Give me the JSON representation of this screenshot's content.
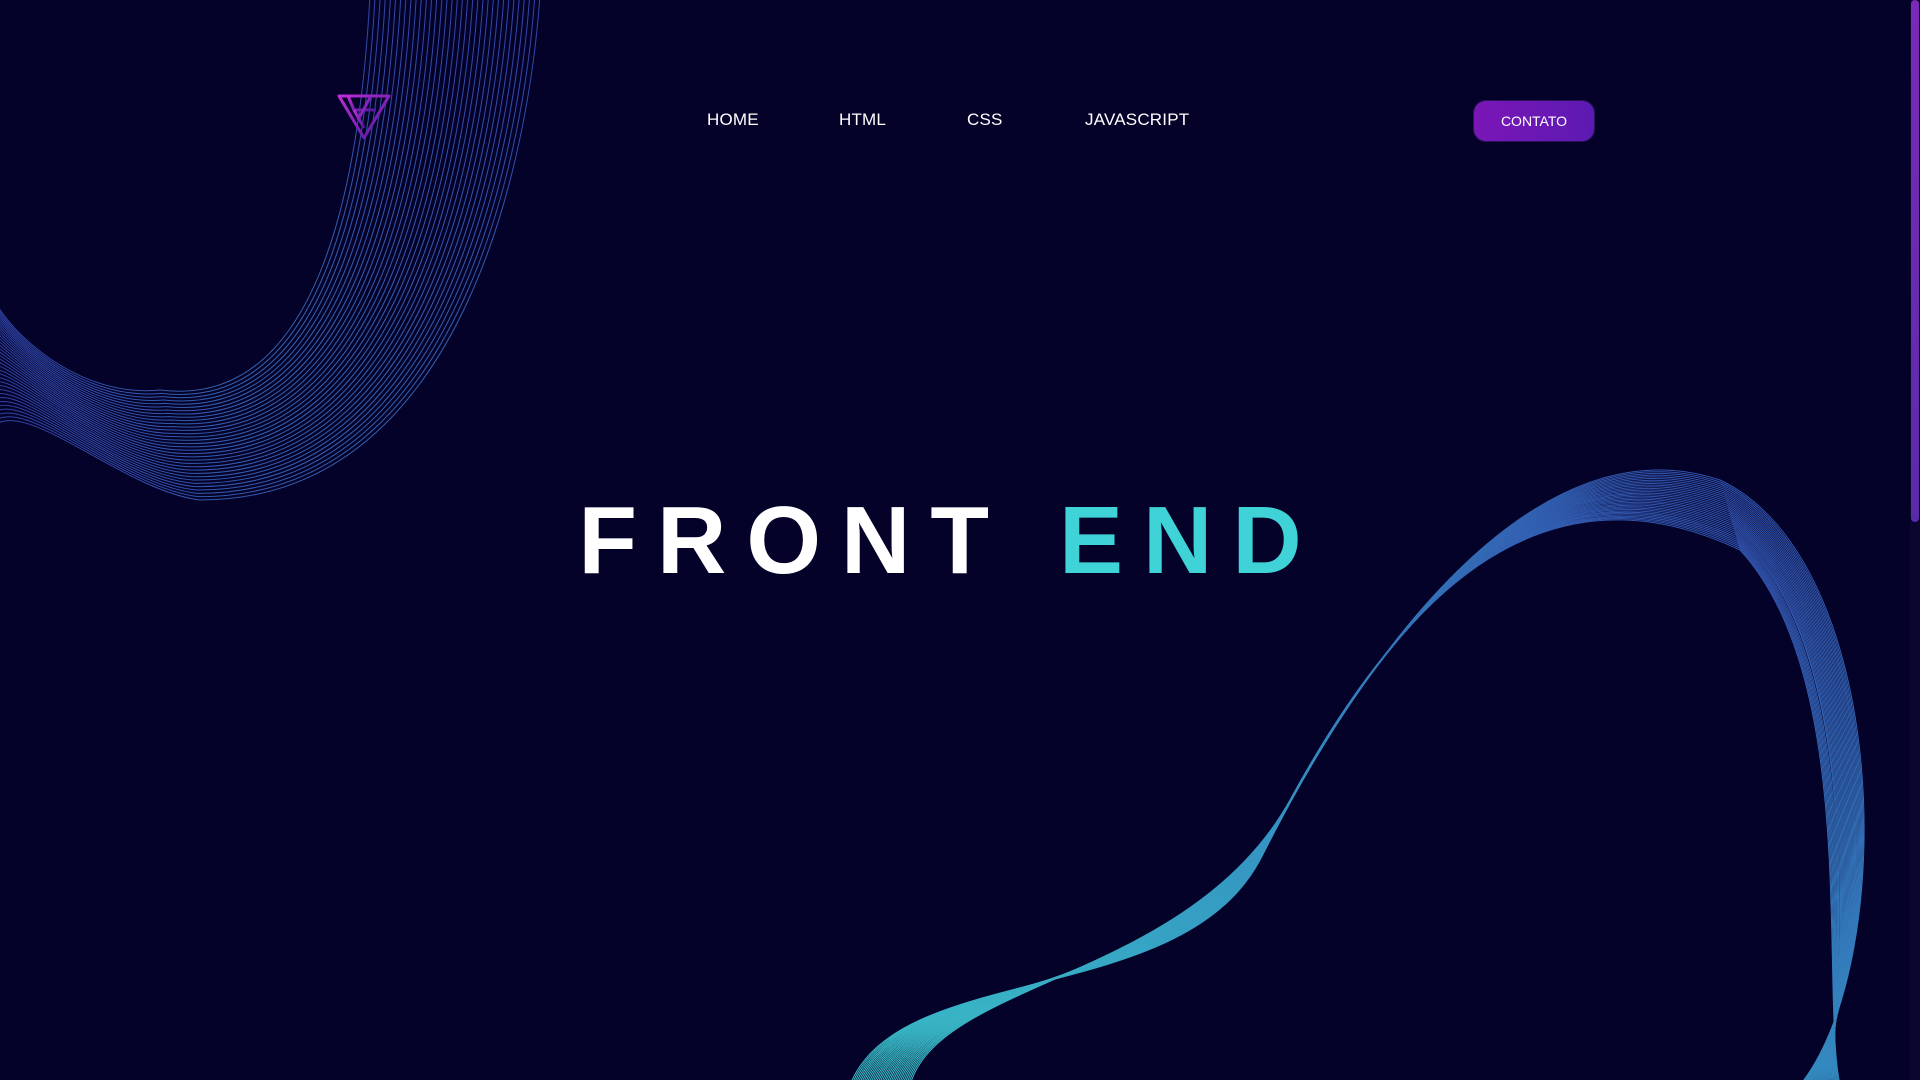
{
  "nav": {
    "home": "HOME",
    "html": "HTML",
    "css": "CSS",
    "javascript": "JAVASCRIPT"
  },
  "cta": {
    "label": "CONTATO"
  },
  "hero": {
    "word1": "FRONT",
    "word2": "END"
  },
  "icons": {
    "logo": "triangle-logo-icon"
  },
  "colors": {
    "background": "#05022a",
    "accent_cyan": "#3fd3d8",
    "accent_purple": "#7a16b6",
    "wave_blue": "#3a4fb8"
  },
  "scroll": {
    "position_fraction": 0.0,
    "visible_fraction": 0.48
  }
}
